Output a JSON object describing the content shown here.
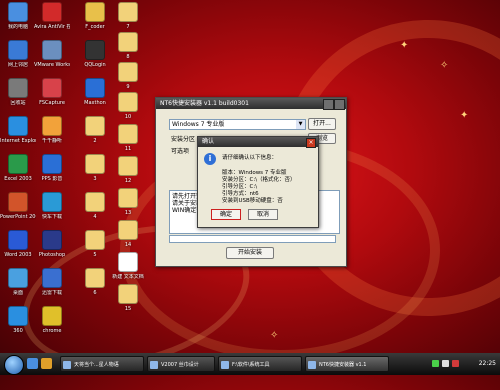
{
  "desktop": {
    "icons": [
      {
        "label": "我的电脑",
        "color": "#4a8fe0"
      },
      {
        "label": "Avira AntiVir 控制中心",
        "color": "#d22a2a"
      },
      {
        "label": "F_coder",
        "color": "#e8c04a"
      },
      {
        "label": "7",
        "color": "#f2d27a"
      },
      {
        "label": "33",
        "color": "#f2d27a"
      },
      {
        "label": "网上邻居",
        "color": "#3a7ad6"
      },
      {
        "label": "VMware Workstation",
        "color": "#6b8fbf"
      },
      {
        "label": "QQLogin",
        "color": "#333333"
      },
      {
        "label": "8",
        "color": "#f2d27a"
      },
      {
        "label": "回收站",
        "color": "#7a7a7a"
      },
      {
        "label": "FSCapture",
        "color": "#d8424a"
      },
      {
        "label": "Maxthon",
        "color": "#2a6fd6"
      },
      {
        "label": "9",
        "color": "#f2d27a"
      },
      {
        "label": "Internet Explorer",
        "color": "#2a8fe0"
      },
      {
        "label": "千千静听",
        "color": "#f2a23a"
      },
      {
        "label": "10",
        "color": "#f2d27a"
      },
      {
        "label": "Excel 2003",
        "color": "#2a9a4a"
      },
      {
        "label": "PPS 影音",
        "color": "#2a6fd6"
      },
      {
        "label": "2",
        "color": "#f2d27a"
      },
      {
        "label": "11",
        "color": "#f2d27a"
      },
      {
        "label": "PowerPoint 2003",
        "color": "#d2542a"
      },
      {
        "label": "快车下载",
        "color": "#2a9ad6"
      },
      {
        "label": "3",
        "color": "#f2d27a"
      },
      {
        "label": "12",
        "color": "#f2d27a"
      },
      {
        "label": "Word 2003",
        "color": "#2a5ad6"
      },
      {
        "label": "Photoshop",
        "color": "#2a3a8a"
      },
      {
        "label": "4",
        "color": "#f2d27a"
      },
      {
        "label": "13",
        "color": "#f2d27a"
      },
      {
        "label": "桌面",
        "color": "#4aa0e0"
      },
      {
        "label": "迅雷下载",
        "color": "#3a6fd0"
      },
      {
        "label": "5",
        "color": "#f2d27a"
      },
      {
        "label": "14",
        "color": "#f2d27a"
      },
      {
        "label": "360",
        "color": "#2a8fe0"
      },
      {
        "label": "chrome",
        "color": "#e0c02a"
      },
      {
        "label": "6",
        "color": "#f2d27a"
      },
      {
        "label": "新建 文本文档",
        "color": "#ffffff"
      },
      {
        "label": "15",
        "color": "#f2d27a"
      }
    ]
  },
  "main_window": {
    "title": "NT6快捷安装器 v1.1 build0301",
    "combo_value": "Windows 7 专业版",
    "open_button": "打开...",
    "section1": "安装分区",
    "section2": "可选项",
    "browse_button": "浏览",
    "log_lines": [
      "请先打开安装",
      "请关于安装",
      "WIN确定安装"
    ],
    "start_button": "开始安装"
  },
  "dialog": {
    "title": "确认",
    "icon_glyph": "i",
    "prompt": "请仔细确认以下信息：",
    "lines": [
      "版本：Windows 7 专业版",
      "安装分区：C:\\（格式化：否）",
      "引导分区：C:\\",
      "引导方式：nt6",
      "安装到USB移动硬盘：否"
    ],
    "ok_label": "确定",
    "cancel_label": "取消",
    "colors": {
      "ok_border": "#cc2020"
    }
  },
  "taskbar": {
    "tasks": [
      "天将当个...星人物语",
      "V2007 丝巾设计",
      "F:\\软件\\系统工具",
      "NT6快捷安装器 v1.1"
    ],
    "clock": "22:25"
  }
}
